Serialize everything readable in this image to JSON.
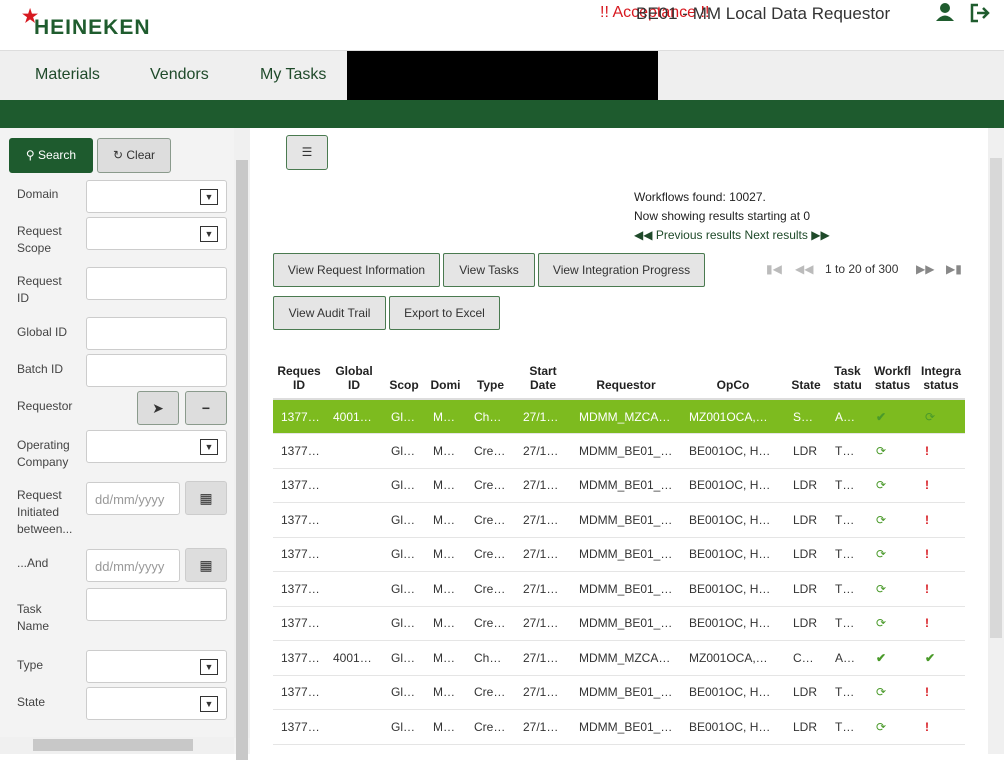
{
  "header": {
    "logo_text": "HEINEKEN",
    "environment": "!! Acceptance !!",
    "app_title": "BE01 - MM Local Data Requestor",
    "user_icon": "user-icon",
    "logout_icon": "logout-icon"
  },
  "nav": {
    "items": [
      "Materials",
      "Vendors",
      "My Tasks"
    ]
  },
  "search": {
    "search_label": "Search",
    "clear_label": "Clear",
    "fields": {
      "domain": "Domain",
      "request_scope_1": "Request",
      "request_scope_2": "Scope",
      "request_id_1": "Request",
      "request_id_2": "ID",
      "global_id": "Global ID",
      "batch_id": "Batch ID",
      "requestor": "Requestor",
      "opco_1": "Operating",
      "opco_2": "Company",
      "initiated_1": "Request",
      "initiated_2": "Initiated",
      "initiated_3": "between...",
      "and": "...And",
      "task_name_1": "Task",
      "task_name_2": "Name",
      "type": "Type",
      "state": "State"
    },
    "date_placeholder": "dd/mm/yyyy"
  },
  "results": {
    "found": "Workflows found: 10027.",
    "showing": "Now showing results starting at 0",
    "prev": "Previous results",
    "next": "Next results",
    "pager_text": "1 to 20 of 300"
  },
  "actions": {
    "view_request": "View Request Information",
    "view_tasks": "View Tasks",
    "view_integration": "View Integration Progress",
    "view_audit": "View Audit Trail",
    "export": "Export to Excel"
  },
  "table": {
    "headers": [
      [
        "Reques",
        "ID"
      ],
      [
        "Global",
        "ID"
      ],
      [
        "",
        "Scop"
      ],
      [
        "",
        "Domi"
      ],
      [
        "",
        "Type"
      ],
      [
        "Start",
        "Date"
      ],
      [
        "",
        "Requestor"
      ],
      [
        "",
        "OpCo"
      ],
      [
        "",
        "State"
      ],
      [
        "Task",
        "statu"
      ],
      [
        "Workfl",
        "status"
      ],
      [
        "Integra",
        "status"
      ]
    ],
    "rows": [
      [
        "1377…",
        "4001…",
        "Gl…",
        "M…",
        "Ch…",
        "27/1…",
        "MDMM_MZCA…",
        "MZ001OCA,…",
        "S…",
        "A…",
        "ok",
        "sync"
      ],
      [
        "1377…",
        "",
        "Gl…",
        "M…",
        "Cre…",
        "27/1…",
        "MDMM_BE01_…",
        "BE001OC, H…",
        "LDR",
        "T…",
        "sync",
        "err"
      ],
      [
        "1377…",
        "",
        "Gl…",
        "M…",
        "Cre…",
        "27/1…",
        "MDMM_BE01_…",
        "BE001OC, H…",
        "LDR",
        "T…",
        "sync",
        "err"
      ],
      [
        "1377…",
        "",
        "Gl…",
        "M…",
        "Cre…",
        "27/1…",
        "MDMM_BE01_…",
        "BE001OC, H…",
        "LDR",
        "T…",
        "sync",
        "err"
      ],
      [
        "1377…",
        "",
        "Gl…",
        "M…",
        "Cre…",
        "27/1…",
        "MDMM_BE01_…",
        "BE001OC, H…",
        "LDR",
        "T…",
        "sync",
        "err"
      ],
      [
        "1377…",
        "",
        "Gl…",
        "M…",
        "Cre…",
        "27/1…",
        "MDMM_BE01_…",
        "BE001OC, H…",
        "LDR",
        "T…",
        "sync",
        "err"
      ],
      [
        "1377…",
        "",
        "Gl…",
        "M…",
        "Cre…",
        "27/1…",
        "MDMM_BE01_…",
        "BE001OC, H…",
        "LDR",
        "T…",
        "sync",
        "err"
      ],
      [
        "1377…",
        "4001…",
        "Gl…",
        "M…",
        "Ch…",
        "27/1…",
        "MDMM_MZCA…",
        "MZ001OCA,…",
        "C…",
        "A…",
        "ok",
        "ok"
      ],
      [
        "1377…",
        "",
        "Gl…",
        "M…",
        "Cre…",
        "27/1…",
        "MDMM_BE01_…",
        "BE001OC, H…",
        "LDR",
        "T…",
        "sync",
        "err"
      ],
      [
        "1377…",
        "",
        "Gl…",
        "M…",
        "Cre…",
        "27/1…",
        "MDMM_BE01_…",
        "BE001OC, H…",
        "LDR",
        "T…",
        "sync",
        "err"
      ]
    ]
  },
  "colors": {
    "brand_green": "#1e5b2e",
    "selected_row": "#7dbb1f",
    "accent_red": "#d71920"
  }
}
